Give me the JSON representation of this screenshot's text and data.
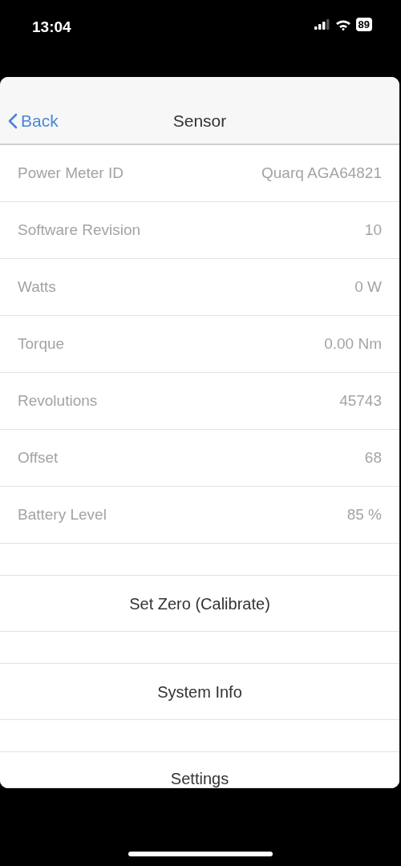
{
  "status_bar": {
    "time": "13:04",
    "battery": "89"
  },
  "nav": {
    "back": "Back",
    "title": "Sensor"
  },
  "rows": [
    {
      "label": "Power Meter ID",
      "value": "Quarq AGA64821"
    },
    {
      "label": "Software Revision",
      "value": "10"
    },
    {
      "label": "Watts",
      "value": "0 W"
    },
    {
      "label": "Torque",
      "value": "0.00 Nm"
    },
    {
      "label": "Revolutions",
      "value": "45743"
    },
    {
      "label": "Offset",
      "value": "68"
    },
    {
      "label": "Battery Level",
      "value": "85 %"
    }
  ],
  "actions": [
    "Set Zero (Calibrate)",
    "System Info",
    "Settings"
  ]
}
